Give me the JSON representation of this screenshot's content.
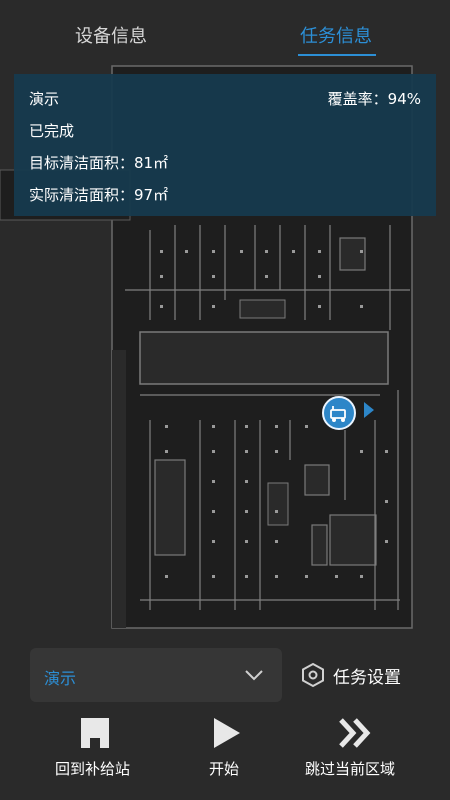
{
  "tabs": {
    "device_info": "设备信息",
    "task_info": "任务信息"
  },
  "panel": {
    "task_name": "演示",
    "coverage": "覆盖率：94%",
    "status": "已完成",
    "target_area": "目标清洁面积：81㎡",
    "actual_area": "实际清洁面积：97㎡"
  },
  "task_select": {
    "value": "演示"
  },
  "settings": {
    "label": "任务设置"
  },
  "actions": {
    "return_label": "回到补给站",
    "start_label": "开始",
    "skip_label": "跳过当前区域"
  },
  "colors": {
    "accent": "#2c8fd6",
    "panel_bg": "#163a4e",
    "background": "#2a2a2a"
  }
}
